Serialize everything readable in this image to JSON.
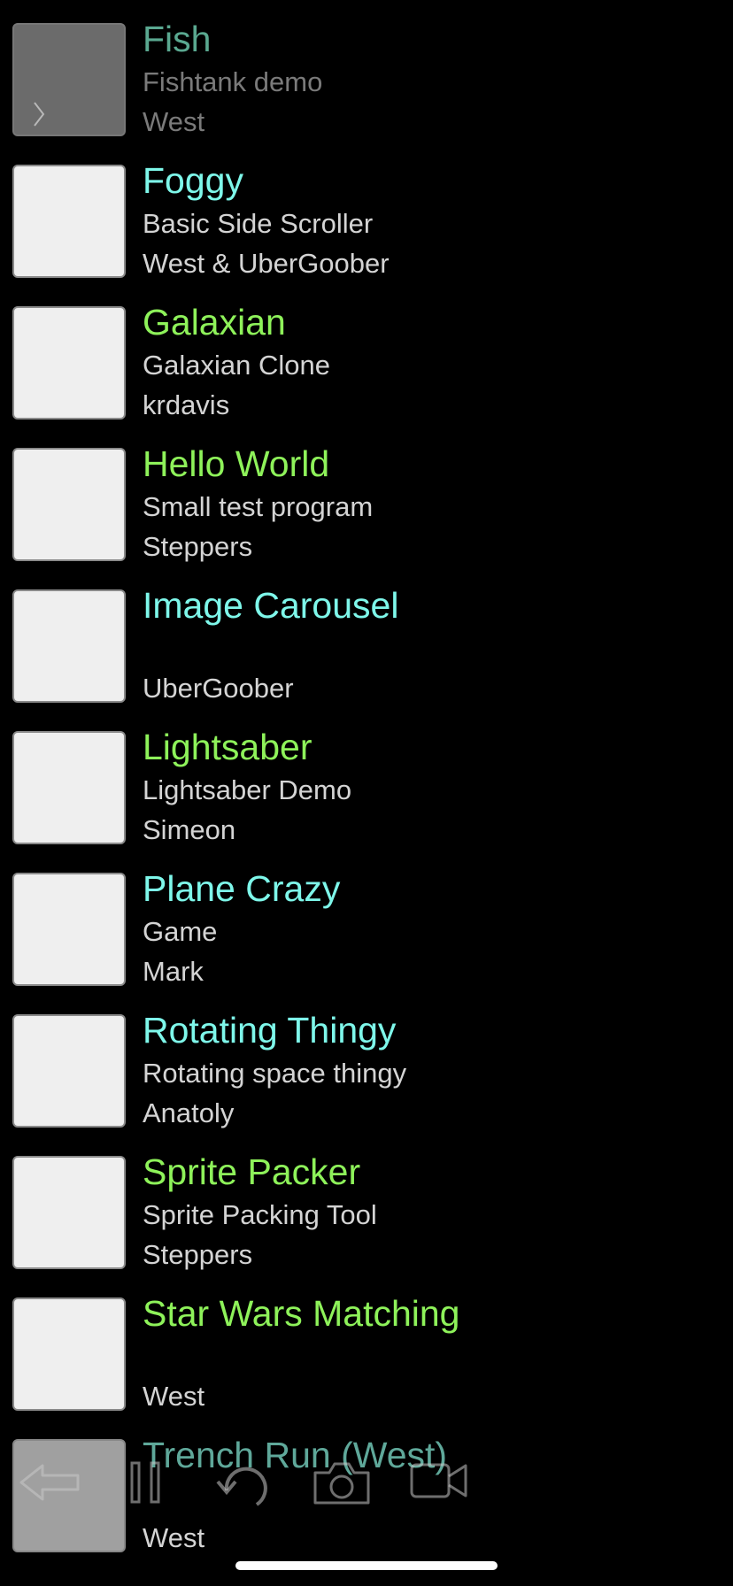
{
  "projects": [
    {
      "title": "Fish",
      "subtitle": "Fishtank demo",
      "author": "West",
      "title_color": "#5aa890"
    },
    {
      "title": "Foggy",
      "subtitle": "Basic Side Scroller",
      "author": "West & UberGoober",
      "title_color": "#7ef7ea"
    },
    {
      "title": "Galaxian",
      "subtitle": "Galaxian Clone",
      "author": "krdavis",
      "title_color": "#8ef25a"
    },
    {
      "title": "Hello World",
      "subtitle": "Small test program",
      "author": "Steppers",
      "title_color": "#8ef25a"
    },
    {
      "title": "Image Carousel",
      "subtitle": "",
      "author": "UberGoober",
      "title_color": "#7ef7ea"
    },
    {
      "title": "Lightsaber",
      "subtitle": "Lightsaber Demo",
      "author": "Simeon",
      "title_color": "#8ef25a"
    },
    {
      "title": "Plane Crazy",
      "subtitle": "Game",
      "author": "Mark",
      "title_color": "#7ef7ea"
    },
    {
      "title": "Rotating Thingy",
      "subtitle": "Rotating space thingy",
      "author": "Anatoly",
      "title_color": "#7ef7ea"
    },
    {
      "title": "Sprite Packer",
      "subtitle": "Sprite Packing Tool",
      "author": "Steppers",
      "title_color": "#8ef25a"
    },
    {
      "title": "Star Wars Matching",
      "subtitle": "",
      "author": "West",
      "title_color": "#8ef25a"
    },
    {
      "title": "Trench Run (West)",
      "subtitle": "",
      "author": "West",
      "title_color": "#5fa89a"
    }
  ],
  "overlay_toolbar": {
    "icons": [
      "back-arrow-icon",
      "pause-icon",
      "restart-icon",
      "camera-icon",
      "video-camera-icon"
    ]
  }
}
